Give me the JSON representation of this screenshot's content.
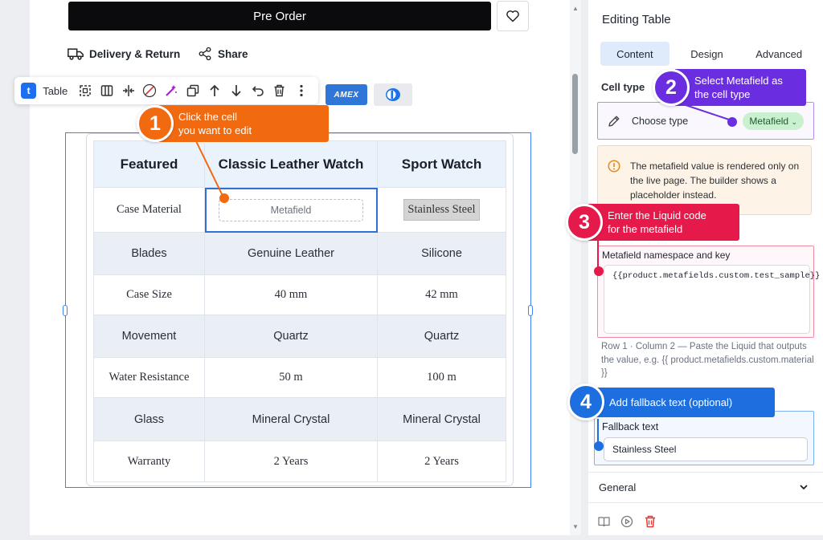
{
  "canvas": {
    "preorder_label": "Pre Order",
    "delivery_label": "Delivery & Return",
    "share_label": "Share",
    "payment_amex": "AMEX"
  },
  "toolbar": {
    "badge": "t",
    "label": "Table",
    "icons": [
      "select-frame-icon",
      "columns-icon",
      "split-icon",
      "no-fill-icon",
      "magic-wand-icon",
      "duplicate-icon",
      "move-up-icon",
      "move-down-icon",
      "undo-icon",
      "delete-icon",
      "more-icon"
    ]
  },
  "table": {
    "headers": [
      "Featured",
      "Classic Leather Watch",
      "Sport Watch"
    ],
    "rows": [
      {
        "label": "Case Material",
        "c1": "Metafield",
        "c2": "Stainless Steel"
      },
      {
        "label": "Blades",
        "c1": "Genuine Leather",
        "c2": "Silicone"
      },
      {
        "label": "Case Size",
        "c1": "40 mm",
        "c2": "42 mm"
      },
      {
        "label": "Movement",
        "c1": "Quartz",
        "c2": "Quartz"
      },
      {
        "label": "Water Resistance",
        "c1": "50 m",
        "c2": "100 m"
      },
      {
        "label": "Glass",
        "c1": "Mineral Crystal",
        "c2": "Mineral Crystal"
      },
      {
        "label": "Warranty",
        "c1": "2 Years",
        "c2": "2 Years"
      }
    ]
  },
  "callouts": {
    "c1": {
      "num": "1",
      "line1": "Click the cell",
      "line2": "you want to edit",
      "color": "#f26a10"
    },
    "c2": {
      "num": "2",
      "line1": "Select Metafield as",
      "line2": "the cell type",
      "color": "#6a2ee0"
    },
    "c3": {
      "num": "3",
      "line1": "Enter the Liquid code",
      "line2": "for the metafield",
      "color": "#e6194b"
    },
    "c4": {
      "num": "4",
      "line1": "Add fallback text (optional)",
      "color": "#1d6fe0"
    }
  },
  "panel": {
    "title": "Editing Table",
    "tabs": [
      "Content",
      "Design",
      "Advanced"
    ],
    "active_tab": "Content",
    "cell_type_label": "Cell type",
    "choose_type_label": "Choose type",
    "type_value": "Metafield",
    "warning": "The metafield value is rendered only on the live page. The builder shows a placeholder instead.",
    "namespace_label": "Metafield namespace and key",
    "namespace_value": "{{product.metafields.custom.test_sample}}",
    "hint": "Row 1 · Column 2 — Paste the Liquid that outputs the value, e.g. {{ product.metafields.custom.material }}",
    "fallback_label": "Fallback text",
    "fallback_value": "Stainless Steel",
    "general_label": "General",
    "footer_icons": [
      "book-icon",
      "play-circle-icon",
      "trash-icon"
    ]
  }
}
